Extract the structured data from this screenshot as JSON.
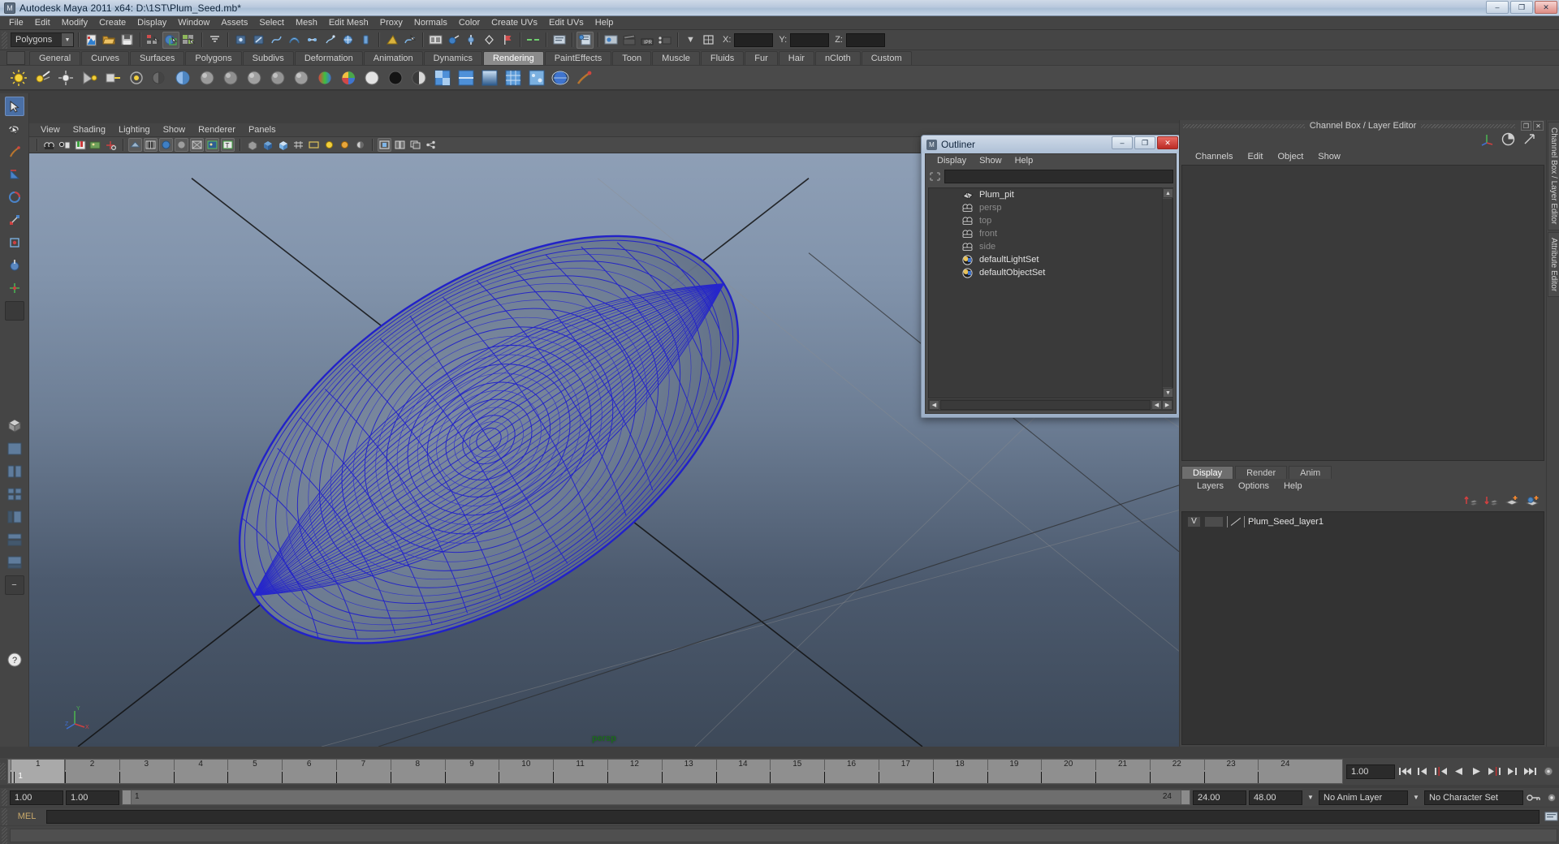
{
  "window": {
    "title": "Autodesk Maya 2011 x64: D:\\1ST\\Plum_Seed.mb*",
    "minimize": "–",
    "maximize": "❐",
    "close": "✕"
  },
  "menubar": {
    "items": [
      "File",
      "Edit",
      "Modify",
      "Create",
      "Display",
      "Window",
      "Assets",
      "Select",
      "Mesh",
      "Edit Mesh",
      "Proxy",
      "Normals",
      "Color",
      "Create UVs",
      "Edit UVs",
      "Help"
    ]
  },
  "statusline": {
    "mode_selected": "Polygons",
    "coord_labels": [
      "X:",
      "Y:",
      "Z:"
    ],
    "coord_values": [
      "",
      "",
      ""
    ]
  },
  "shelf": {
    "tabs": [
      "General",
      "Curves",
      "Surfaces",
      "Polygons",
      "Subdivs",
      "Deformation",
      "Animation",
      "Dynamics",
      "Rendering",
      "PaintEffects",
      "Toon",
      "Muscle",
      "Fluids",
      "Fur",
      "Hair",
      "nCloth",
      "Custom"
    ],
    "active_tab": "Rendering"
  },
  "viewport": {
    "panel_menu": [
      "View",
      "Shading",
      "Lighting",
      "Show",
      "Renderer",
      "Panels"
    ],
    "camera_label": "persp",
    "axis": {
      "x": "X",
      "y": "Y",
      "z": "Z"
    },
    "object_wire_color": "#2020c8",
    "bg_top": "#8a9cb4",
    "bg_bottom": "#3e4a5c"
  },
  "outliner": {
    "title": "Outliner",
    "menu": [
      "Display",
      "Show",
      "Help"
    ],
    "search_value": "",
    "items": [
      {
        "label": "Plum_pit",
        "icon": "mesh-icon",
        "dim": false
      },
      {
        "label": "persp",
        "icon": "camera-icon",
        "dim": true
      },
      {
        "label": "top",
        "icon": "camera-icon",
        "dim": true
      },
      {
        "label": "front",
        "icon": "camera-icon",
        "dim": true
      },
      {
        "label": "side",
        "icon": "camera-icon",
        "dim": true
      },
      {
        "label": "defaultLightSet",
        "icon": "set-icon",
        "dim": false
      },
      {
        "label": "defaultObjectSet",
        "icon": "set-icon",
        "dim": false
      }
    ],
    "buttons": {
      "minimize": "–",
      "maximize": "❐",
      "close": "✕"
    }
  },
  "rightdock": {
    "title": "Channel Box / Layer Editor",
    "menu": [
      "Channels",
      "Edit",
      "Object",
      "Show"
    ],
    "vertical_tab": "Channel Box / Layer Editor",
    "attribute_tab": "Attribute Editor",
    "float_btn": "❐",
    "close_btn": "✕"
  },
  "layereditor": {
    "tabs": [
      "Display",
      "Render",
      "Anim"
    ],
    "active_tab": "Display",
    "menu": [
      "Layers",
      "Options",
      "Help"
    ],
    "layers": [
      {
        "visibility": "V",
        "type": "",
        "name": "Plum_Seed_layer1"
      }
    ]
  },
  "timeline": {
    "ticks": [
      1,
      2,
      3,
      4,
      5,
      6,
      7,
      8,
      9,
      10,
      11,
      12,
      13,
      14,
      15,
      16,
      17,
      18,
      19,
      20,
      21,
      22,
      23,
      24
    ],
    "current_frame": "1",
    "current_frame_field": "1.00",
    "range_start": "1.00",
    "range_end": "1.00",
    "range_bar_start": "1",
    "range_bar_end": "24",
    "anim_start": "24.00",
    "anim_end": "48.00",
    "anim_layer": "No Anim Layer",
    "character_set": "No Character Set"
  },
  "commandline": {
    "label": "MEL",
    "value": "",
    "help_value": ""
  }
}
